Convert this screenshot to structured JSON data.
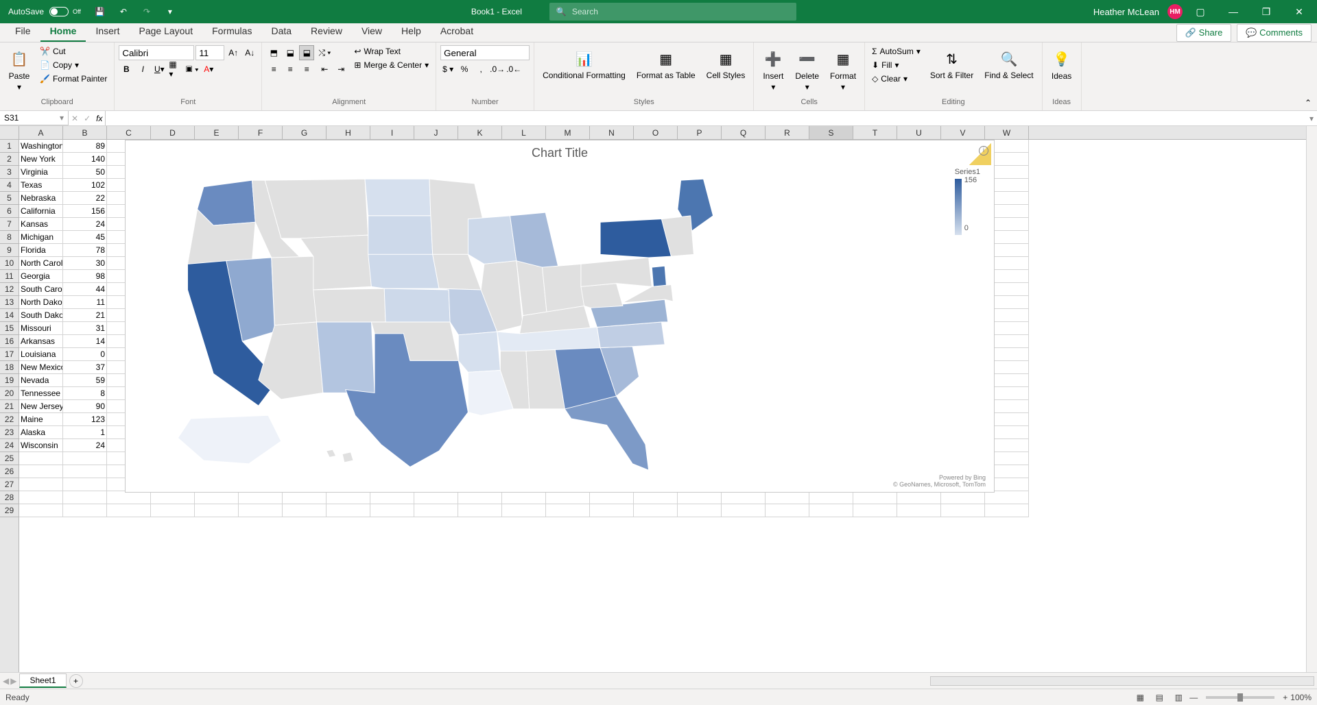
{
  "titlebar": {
    "autosave_label": "AutoSave",
    "autosave_state": "Off",
    "doc_title": "Book1 - Excel",
    "search_placeholder": "Search",
    "user_name": "Heather McLean",
    "user_initials": "HM"
  },
  "tabs": {
    "items": [
      "File",
      "Home",
      "Insert",
      "Page Layout",
      "Formulas",
      "Data",
      "Review",
      "View",
      "Help",
      "Acrobat"
    ],
    "active": "Home",
    "share": "Share",
    "comments": "Comments"
  },
  "ribbon": {
    "clipboard": {
      "label": "Clipboard",
      "paste": "Paste",
      "cut": "Cut",
      "copy": "Copy",
      "painter": "Format Painter"
    },
    "font": {
      "label": "Font",
      "name": "Calibri",
      "size": "11"
    },
    "alignment": {
      "label": "Alignment",
      "wrap": "Wrap Text",
      "merge": "Merge & Center"
    },
    "number": {
      "label": "Number",
      "format": "General"
    },
    "styles": {
      "label": "Styles",
      "cond": "Conditional Formatting",
      "table": "Format as Table",
      "cell": "Cell Styles"
    },
    "cells": {
      "label": "Cells",
      "insert": "Insert",
      "delete": "Delete",
      "format": "Format"
    },
    "editing": {
      "label": "Editing",
      "autosum": "AutoSum",
      "fill": "Fill",
      "clear": "Clear",
      "sort": "Sort & Filter",
      "find": "Find & Select"
    },
    "ideas": {
      "label": "Ideas",
      "btn": "Ideas"
    }
  },
  "formula_bar": {
    "name_box": "S31",
    "fx": "fx"
  },
  "columns": [
    "A",
    "B",
    "C",
    "D",
    "E",
    "F",
    "G",
    "H",
    "I",
    "J",
    "K",
    "L",
    "M",
    "N",
    "O",
    "P",
    "Q",
    "R",
    "S",
    "T",
    "U",
    "V",
    "W"
  ],
  "selected_col": "S",
  "rows": 29,
  "cell_data": [
    [
      "Washington",
      89
    ],
    [
      "New York",
      140
    ],
    [
      "Virginia",
      50
    ],
    [
      "Texas",
      102
    ],
    [
      "Nebraska",
      22
    ],
    [
      "California",
      156
    ],
    [
      "Kansas",
      24
    ],
    [
      "Michigan",
      45
    ],
    [
      "Florida",
      78
    ],
    [
      "North Carolina",
      30
    ],
    [
      "Georgia",
      98
    ],
    [
      "South Carolina",
      44
    ],
    [
      "North Dakota",
      11
    ],
    [
      "South Dakota",
      21
    ],
    [
      "Missouri",
      31
    ],
    [
      "Arkansas",
      14
    ],
    [
      "Louisiana",
      0
    ],
    [
      "New Mexico",
      37
    ],
    [
      "Nevada",
      59
    ],
    [
      "Tennessee",
      8
    ],
    [
      "New Jersey",
      90
    ],
    [
      "Maine",
      123
    ],
    [
      "Alaska",
      1
    ],
    [
      "Wisconsin",
      24
    ]
  ],
  "chart": {
    "title": "Chart Title",
    "series_name": "Series1",
    "scale_max": "156",
    "scale_min": "0",
    "powered": "Powered by Bing",
    "attrib": "© GeoNames, Microsoft, TomTom"
  },
  "chart_data": {
    "type": "map",
    "title": "Chart Title",
    "series": [
      {
        "name": "Series1"
      }
    ],
    "color_scale": {
      "min": 0,
      "max": 156,
      "low_color": "#d6e0ee",
      "high_color": "#2e5c9e",
      "na_color": "#e0e0e0"
    },
    "regions": [
      {
        "region": "Washington",
        "value": 89
      },
      {
        "region": "New York",
        "value": 140
      },
      {
        "region": "Virginia",
        "value": 50
      },
      {
        "region": "Texas",
        "value": 102
      },
      {
        "region": "Nebraska",
        "value": 22
      },
      {
        "region": "California",
        "value": 156
      },
      {
        "region": "Kansas",
        "value": 24
      },
      {
        "region": "Michigan",
        "value": 45
      },
      {
        "region": "Florida",
        "value": 78
      },
      {
        "region": "North Carolina",
        "value": 30
      },
      {
        "region": "Georgia",
        "value": 98
      },
      {
        "region": "South Carolina",
        "value": 44
      },
      {
        "region": "North Dakota",
        "value": 11
      },
      {
        "region": "South Dakota",
        "value": 21
      },
      {
        "region": "Missouri",
        "value": 31
      },
      {
        "region": "Arkansas",
        "value": 14
      },
      {
        "region": "Louisiana",
        "value": 0
      },
      {
        "region": "New Mexico",
        "value": 37
      },
      {
        "region": "Nevada",
        "value": 59
      },
      {
        "region": "Tennessee",
        "value": 8
      },
      {
        "region": "New Jersey",
        "value": 90
      },
      {
        "region": "Maine",
        "value": 123
      },
      {
        "region": "Alaska",
        "value": 1
      },
      {
        "region": "Wisconsin",
        "value": 24
      }
    ]
  },
  "sheet_tabs": {
    "active": "Sheet1"
  },
  "status": {
    "ready": "Ready",
    "zoom": "100%"
  }
}
